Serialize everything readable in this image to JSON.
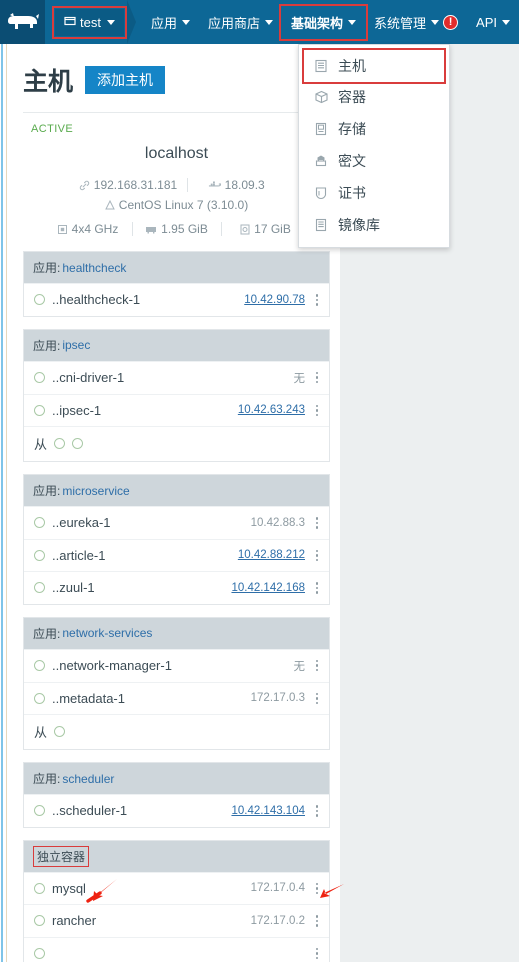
{
  "navbar": {
    "logo_icon": "cow-logo-icon",
    "env": {
      "label": "test",
      "icon": "cube-icon",
      "highlighted": true
    },
    "items": [
      {
        "label": "应用",
        "icon": "chevron-down-icon",
        "active": false,
        "badge": null
      },
      {
        "label": "应用商店",
        "icon": "chevron-down-icon",
        "active": false,
        "badge": null
      },
      {
        "label": "基础架构",
        "icon": "chevron-down-icon",
        "active": true,
        "badge": null
      },
      {
        "label": "系统管理",
        "icon": "chevron-down-icon",
        "active": false,
        "badge": "!"
      },
      {
        "label": "API",
        "icon": "chevron-down-icon",
        "active": false,
        "badge": null
      }
    ],
    "background": "#0d6796",
    "highlight_color": "#d93c3c"
  },
  "dropdown": {
    "open_for": "基础架构",
    "items": [
      {
        "label": "主机",
        "icon": "server-icon",
        "selected": true
      },
      {
        "label": "容器",
        "icon": "box-icon",
        "selected": false
      },
      {
        "label": "存储",
        "icon": "storage-icon",
        "selected": false
      },
      {
        "label": "密文",
        "icon": "secret-icon",
        "selected": false
      },
      {
        "label": "证书",
        "icon": "certificate-icon",
        "selected": false
      },
      {
        "label": "镜像库",
        "icon": "registry-icon",
        "selected": false
      }
    ]
  },
  "page": {
    "title": "主机",
    "add_host_button": "添加主机"
  },
  "host": {
    "state": "ACTIVE",
    "name": "localhost",
    "pause_button_icon": "pause-icon",
    "ip": "192.168.31.181",
    "ip_icon": "link-icon",
    "docker_version": "18.09.3",
    "docker_icon": "docker-icon",
    "os": "CentOS Linux 7 (3.10.0)",
    "os_icon": "triangle-icon",
    "cpu": "4x4 GHz",
    "cpu_icon": "cpu-icon",
    "memory": "1.95 GiB",
    "memory_icon": "memory-icon",
    "disk": "17 GiB",
    "disk_icon": "disk-icon"
  },
  "groups": [
    {
      "prefix": "应用:",
      "name": "healthcheck",
      "highlighted": false,
      "rows": [
        {
          "type": "service",
          "name": "..healthcheck-1",
          "ip": "10.42.90.78",
          "ip_is_link": true
        }
      ]
    },
    {
      "prefix": "应用:",
      "name": "ipsec",
      "highlighted": false,
      "rows": [
        {
          "type": "service",
          "name": "..cni-driver-1",
          "ip": "无",
          "ip_is_link": false
        },
        {
          "type": "service",
          "name": "..ipsec-1",
          "ip": "10.42.63.243",
          "ip_is_link": true
        },
        {
          "type": "slave",
          "label": "从",
          "count": 2
        }
      ]
    },
    {
      "prefix": "应用:",
      "name": "microservice",
      "highlighted": false,
      "rows": [
        {
          "type": "service",
          "name": "..eureka-1",
          "ip": "10.42.88.3",
          "ip_is_link": false
        },
        {
          "type": "service",
          "name": "..article-1",
          "ip": "10.42.88.212",
          "ip_is_link": true
        },
        {
          "type": "service",
          "name": "..zuul-1",
          "ip": "10.42.142.168",
          "ip_is_link": true
        }
      ]
    },
    {
      "prefix": "应用:",
      "name": "network-services",
      "highlighted": false,
      "rows": [
        {
          "type": "service",
          "name": "..network-manager-1",
          "ip": "无",
          "ip_is_link": false
        },
        {
          "type": "service",
          "name": "..metadata-1",
          "ip": "172.17.0.3",
          "ip_is_link": false
        },
        {
          "type": "slave",
          "label": "从",
          "count": 1
        }
      ]
    },
    {
      "prefix": "应用:",
      "name": "scheduler",
      "highlighted": false,
      "rows": [
        {
          "type": "service",
          "name": "..scheduler-1",
          "ip": "10.42.143.104",
          "ip_is_link": true
        }
      ]
    },
    {
      "prefix": "",
      "name": "独立容器",
      "highlighted": true,
      "rows": [
        {
          "type": "service",
          "name": "mysql",
          "ip": "172.17.0.4",
          "ip_is_link": false
        },
        {
          "type": "service",
          "name": "rancher",
          "ip": "172.17.0.2",
          "ip_is_link": false
        },
        {
          "type": "service",
          "name": "",
          "ip": "",
          "ip_is_link": false
        }
      ]
    }
  ],
  "annotations": {
    "arrow_color": "#ee2211",
    "arrows": [
      {
        "name": "arrow-pointing-to-mysql"
      },
      {
        "name": "arrow-pointing-to-mysql-kebab"
      }
    ]
  }
}
